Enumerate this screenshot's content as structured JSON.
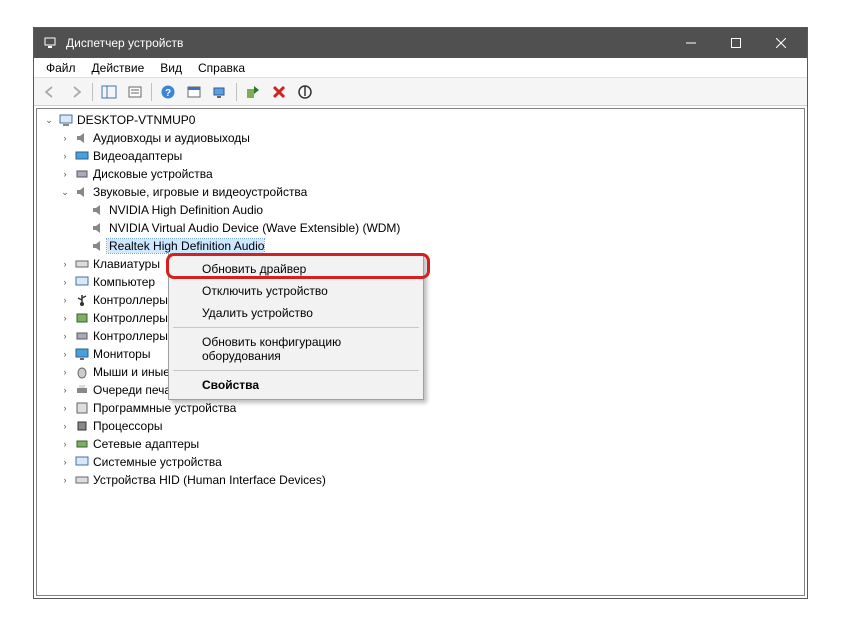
{
  "window": {
    "title": "Диспетчер устройств"
  },
  "menubar": {
    "file": "Файл",
    "action": "Действие",
    "view": "Вид",
    "help": "Справка"
  },
  "tree": {
    "root": "DESKTOP-VTNMUP0",
    "audio_io": "Аудиовходы и аудиовыходы",
    "video_adapters": "Видеоадаптеры",
    "disk_drives": "Дисковые устройства",
    "sound_game_video": "Звуковые, игровые и видеоустройства",
    "nvidia_hda": "NVIDIA High Definition Audio",
    "nvidia_virtual": "NVIDIA Virtual Audio Device (Wave Extensible) (WDM)",
    "realtek": "Realtek High Definition Audio",
    "keyboards": "Клавиатуры",
    "computer": "Компьютер",
    "usb_ctrl": "Контроллеры USB",
    "storage_ctrl": "Контроллеры запоминающих устройств",
    "ide_ctrl": "Контроллеры IDE ATA/ATAPI",
    "monitors": "Мониторы",
    "mice": "Мыши и иные указывающие устройства",
    "print_queues": "Очереди печати",
    "software_devices": "Программные устройства",
    "processors": "Процессоры",
    "network_adapters": "Сетевые адаптеры",
    "system_devices": "Системные устройства",
    "hid": "Устройства HID (Human Interface Devices)"
  },
  "context_menu": {
    "update_driver": "Обновить драйвер",
    "disable_device": "Отключить устройство",
    "uninstall_device": "Удалить устройство",
    "scan_hardware": "Обновить конфигурацию оборудования",
    "properties": "Свойства"
  }
}
